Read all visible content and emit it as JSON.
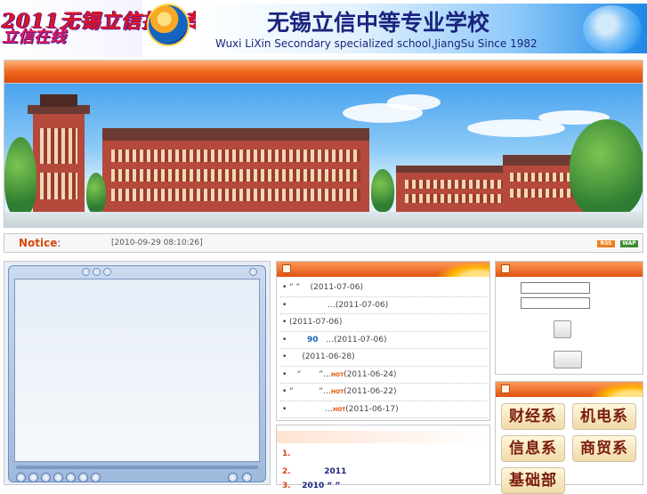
{
  "header": {
    "slogan_line1": "2011无锡立信拾虹专程",
    "slogan_line2": "立信在线",
    "school_name": "无锡立信中等专业学校",
    "school_name_en": "Wuxi LiXin Secondary specialized school,JiangSu Since 1982"
  },
  "notice": {
    "title_main": "Notice",
    "title_colon": ":",
    "timestamp": "[2010-09-29 08:10:26]",
    "badges": [
      "RSS",
      "WAP"
    ]
  },
  "news": {
    "items": [
      {
        "prefix": "“ ”",
        "mid": "",
        "hot": "",
        "date": "(2011-07-06)"
      },
      {
        "prefix": "",
        "mid": "…",
        "hot": "",
        "date": "(2011-07-06)"
      },
      {
        "prefix": "",
        "mid": "",
        "hot": "",
        "date": "(2011-07-06)"
      },
      {
        "prefix": "90",
        "mid": "…",
        "hot": "",
        "date": "(2011-07-06)"
      },
      {
        "prefix": "",
        "mid": "",
        "hot": "",
        "date": "(2011-06-28)"
      },
      {
        "prefix": "“",
        "mid": "”…",
        "hot": "HOT",
        "date": "(2011-06-24)"
      },
      {
        "prefix": "“",
        "mid": "”…",
        "hot": "HOT",
        "date": "(2011-06-22)"
      },
      {
        "prefix": "",
        "mid": "…",
        "hot": "HOT",
        "date": "(2011-06-17)"
      }
    ]
  },
  "notice_list": {
    "items": [
      {
        "num": "1.",
        "text": ""
      },
      {
        "num": "2.",
        "text": "2011"
      },
      {
        "num": "3.",
        "text": "2010 “ ”"
      }
    ]
  },
  "departments": {
    "items": [
      "财经系",
      "机电系",
      "信息系",
      "商贸系",
      "基础部"
    ]
  },
  "colors": {
    "nav_orange": "#f06a1e",
    "school_blue": "#1a237e",
    "slogan_red": "#e0141e"
  }
}
